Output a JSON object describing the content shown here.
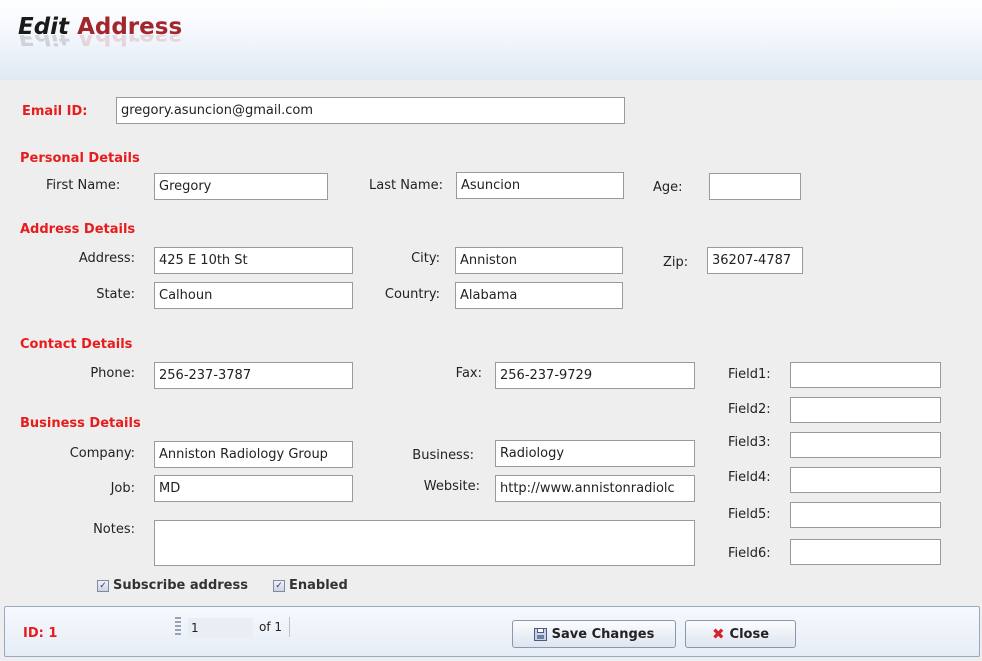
{
  "header": {
    "title_word1": "Edit",
    "title_word2": "Address"
  },
  "email": {
    "label": "Email ID:",
    "value": "gregory.asuncion@gmail.com"
  },
  "personal": {
    "heading": "Personal Details",
    "first_name_label": "First Name:",
    "first_name": "Gregory",
    "last_name_label": "Last Name:",
    "last_name": "Asuncion",
    "age_label": "Age:",
    "age": ""
  },
  "address": {
    "heading": "Address Details",
    "address_label": "Address:",
    "address": "425 E 10th St",
    "city_label": "City:",
    "city": "Anniston",
    "zip_label": "Zip:",
    "zip": "36207-4787",
    "state_label": "State:",
    "state": "Calhoun",
    "country_label": "Country:",
    "country": "Alabama"
  },
  "contact": {
    "heading": "Contact Details",
    "phone_label": "Phone:",
    "phone": "256-237-3787",
    "fax_label": "Fax:",
    "fax": "256-237-9729"
  },
  "custom_fields": [
    {
      "label": "Field1:",
      "value": ""
    },
    {
      "label": "Field2:",
      "value": ""
    },
    {
      "label": "Field3:",
      "value": ""
    },
    {
      "label": "Field4:",
      "value": ""
    },
    {
      "label": "Field5:",
      "value": ""
    },
    {
      "label": "Field6:",
      "value": ""
    }
  ],
  "business": {
    "heading": "Business Details",
    "company_label": "Company:",
    "company": "Anniston Radiology Group",
    "business_label": "Business:",
    "business": "Radiology",
    "job_label": "Job:",
    "job": "MD",
    "website_label": "Website:",
    "website": "http://www.annistonradiolc",
    "notes_label": "Notes:",
    "notes": ""
  },
  "options": {
    "subscribe_label": "Subscribe address",
    "subscribe_checked": true,
    "enabled_label": "Enabled",
    "enabled_checked": true
  },
  "footer": {
    "id_text": "ID:  1",
    "page_value": "1",
    "page_of": "of 1",
    "save_label": "Save Changes",
    "close_label": "Close"
  },
  "icons": {
    "save": "floppy-disk-icon",
    "close": "x-mark-icon",
    "checkbox": "checkmark-icon"
  },
  "colors": {
    "section_heading": "#e81c1c",
    "title_accent": "#a3262a",
    "header_bg": "#dfe8f4"
  }
}
